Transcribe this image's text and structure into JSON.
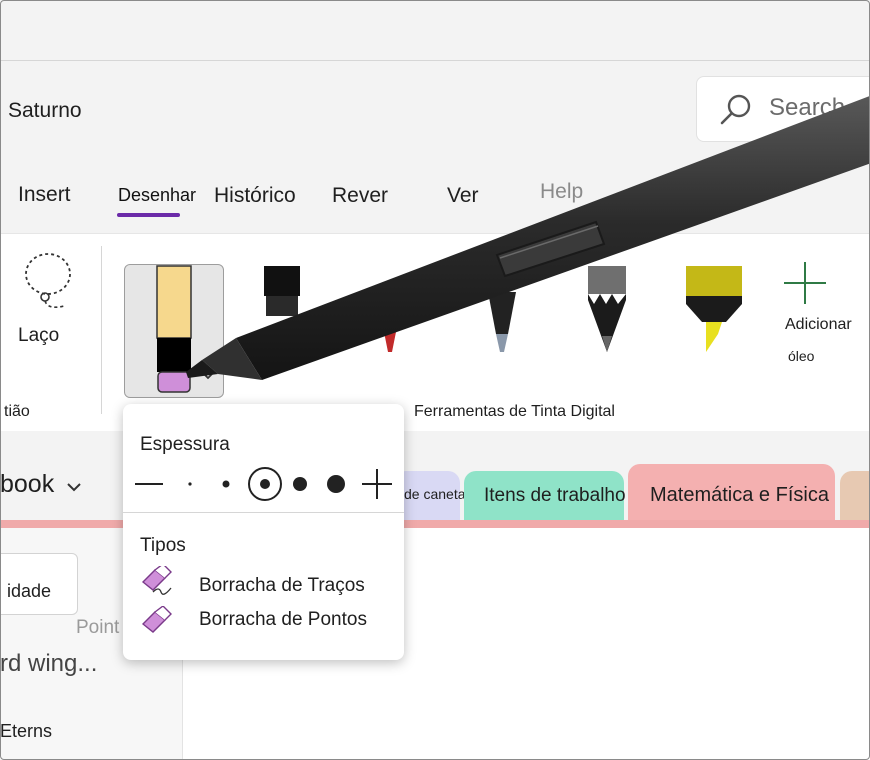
{
  "app": {
    "title": "Saturno",
    "search_placeholder": "Search"
  },
  "tabs": [
    {
      "label": "Insert",
      "active": false
    },
    {
      "label": "Desenhar",
      "active": true
    },
    {
      "label": "Histórico",
      "active": false
    },
    {
      "label": "Rever",
      "active": false
    },
    {
      "label": "Ver",
      "active": false
    },
    {
      "label": "Help",
      "active": false
    }
  ],
  "ribbon": {
    "lasso_label": "Laço",
    "left_group_label": "tião",
    "group_label": "Ferramentas de Tinta Digital",
    "add_label": "Adicionar",
    "add_sub_label": "óleo"
  },
  "notebook": {
    "name": "book"
  },
  "sections": [
    {
      "label": "de caneta",
      "color": "#d9d9f4"
    },
    {
      "label": "Itens de trabalho",
      "color": "#8fe3c8"
    },
    {
      "label": "Matemática e Física",
      "color": "#f4b0b0"
    }
  ],
  "pages": {
    "add_label": "idade",
    "item1": "rd wing...",
    "item2": "Eterns"
  },
  "popup": {
    "thickness_title": "Espessura",
    "types_title": "Tipos",
    "items": [
      {
        "label": "Borracha de Traços"
      },
      {
        "label": "Borracha de Pontos"
      }
    ],
    "ghost_label": "Point Eraser"
  },
  "colors": {
    "accent": "#6b2aa8",
    "eraser": "#cf8fd9",
    "section_pink": "#f0aaaa"
  }
}
